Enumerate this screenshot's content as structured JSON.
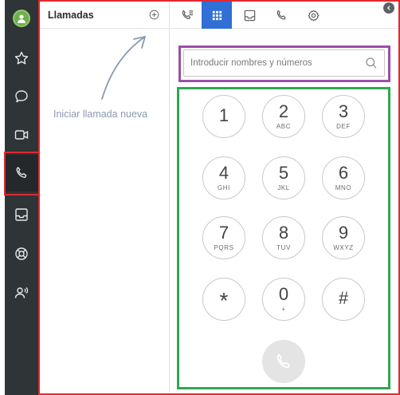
{
  "rail": {
    "items": [
      {
        "icon": "avatar-icon"
      },
      {
        "icon": "star-icon"
      },
      {
        "icon": "chat-icon"
      },
      {
        "icon": "video-icon"
      },
      {
        "icon": "phone-icon",
        "active": true
      },
      {
        "icon": "inbox-icon"
      },
      {
        "icon": "lifebuoy-icon"
      },
      {
        "icon": "contacts-voice-icon"
      }
    ]
  },
  "calls": {
    "title": "Llamadas",
    "hint": "Iniciar llamada nueva"
  },
  "toolbar": {
    "buttons": [
      {
        "icon": "call-log-icon"
      },
      {
        "icon": "dialpad-icon",
        "active": true
      },
      {
        "icon": "inbox-icon"
      },
      {
        "icon": "phone-icon"
      },
      {
        "icon": "gear-icon"
      }
    ]
  },
  "search": {
    "placeholder": "Introducir nombres y números",
    "value": ""
  },
  "dialpad": {
    "keys": [
      {
        "num": "1",
        "sub": ""
      },
      {
        "num": "2",
        "sub": "ABC"
      },
      {
        "num": "3",
        "sub": "DEF"
      },
      {
        "num": "4",
        "sub": "GHI"
      },
      {
        "num": "5",
        "sub": "JKL"
      },
      {
        "num": "6",
        "sub": "MNO"
      },
      {
        "num": "7",
        "sub": "PQRS"
      },
      {
        "num": "8",
        "sub": "TUV"
      },
      {
        "num": "9",
        "sub": "WXYZ"
      },
      {
        "num": "*",
        "sub": ""
      },
      {
        "num": "0",
        "sub": "+"
      },
      {
        "num": "#",
        "sub": ""
      }
    ]
  },
  "colors": {
    "rail": "#2f3437",
    "accent": "#2f6fd6",
    "annotation_red": "#e0292f",
    "annotation_purple": "#9b4fa8",
    "annotation_green": "#2fa84f",
    "hint_text": "#8a9aae"
  }
}
